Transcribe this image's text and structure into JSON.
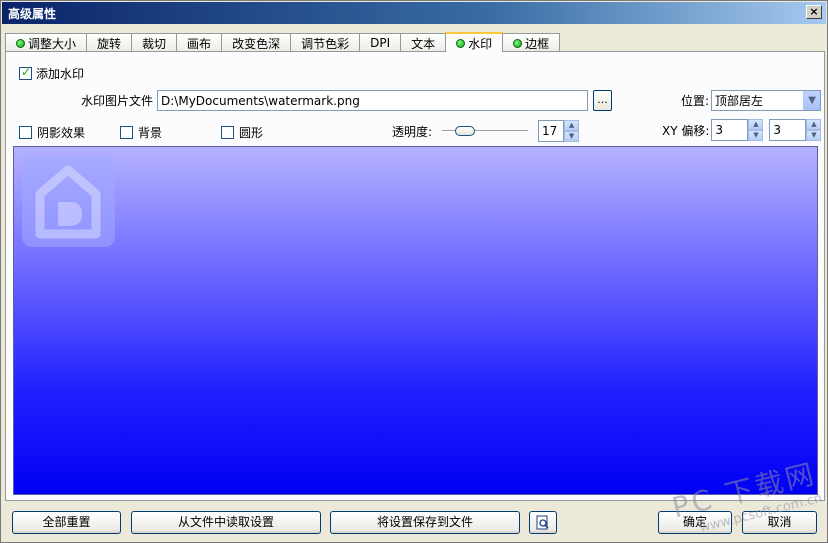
{
  "window": {
    "title": "高级属性",
    "close_label": "×"
  },
  "tabs": [
    {
      "label": "调整大小",
      "dot": true
    },
    {
      "label": "旋转",
      "dot": false
    },
    {
      "label": "裁切",
      "dot": false
    },
    {
      "label": "画布",
      "dot": false
    },
    {
      "label": "改变色深",
      "dot": false
    },
    {
      "label": "调节色彩",
      "dot": false
    },
    {
      "label": "DPI",
      "dot": false
    },
    {
      "label": "文本",
      "dot": false
    },
    {
      "label": "水印",
      "dot": true,
      "active": true
    },
    {
      "label": "边框",
      "dot": true
    }
  ],
  "watermark": {
    "add_label": "添加水印",
    "add_checked": true,
    "file_label": "水印图片文件",
    "file_value": "D:\\MyDocuments\\watermark.png",
    "browse_label": "...",
    "position_label": "位置:",
    "position_value": "顶部居左",
    "shadow_label": "阴影效果",
    "background_label": "背景",
    "round_label": "圆形",
    "opacity_label": "透明度:",
    "opacity_value": "17",
    "opacity_level": 0.17,
    "offset_label": "XY 偏移:",
    "offset_x": "3",
    "offset_y": "3"
  },
  "buttons": {
    "reset": "全部重置",
    "load": "从文件中读取设置",
    "save": "将设置保存到文件",
    "ok": "确定",
    "cancel": "取消"
  },
  "site_watermark": {
    "line1": "PC 下载网",
    "line2": "www.pcsoft.com.cn"
  },
  "colors": {
    "preview_top": "#b5b2ff",
    "preview_bottom": "#0000f4",
    "accent_dot": "#21a121"
  }
}
